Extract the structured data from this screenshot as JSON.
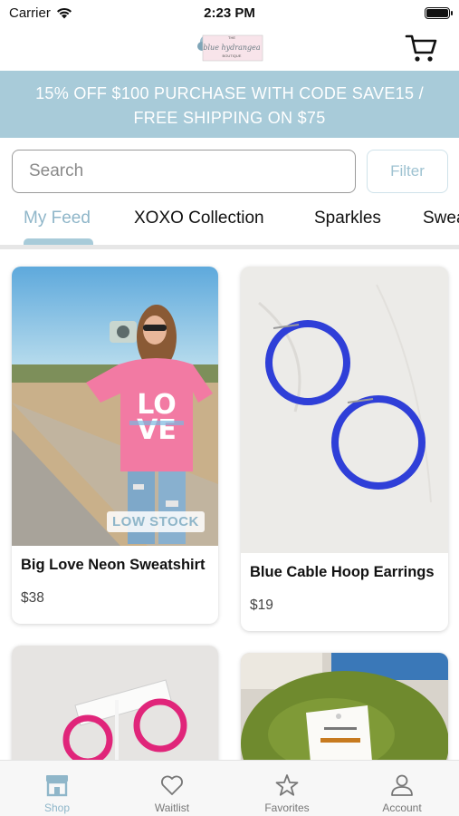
{
  "status_bar": {
    "carrier": "Carrier",
    "time": "2:23 PM"
  },
  "header": {
    "logo_text": "the blue hydrangea boutique",
    "cart_icon": "cart-icon"
  },
  "promo": {
    "line1": "15% OFF $100 PURCHASE WITH CODE SAVE15 /",
    "line2": "FREE SHIPPING ON $75"
  },
  "search": {
    "placeholder": "Search",
    "filter_label": "Filter"
  },
  "tabs": [
    {
      "label": "My Feed",
      "active": true
    },
    {
      "label": "XOXO Collection",
      "active": false
    },
    {
      "label": "Sparkles",
      "active": false
    },
    {
      "label": "Swea",
      "active": false
    }
  ],
  "products": [
    {
      "title": "Big Love Neon Sweatshirt",
      "price": "$38",
      "badge": "LOW STOCK"
    },
    {
      "title": "Blue Cable Hoop Earrings",
      "price": "$19",
      "badge": ""
    },
    {
      "title": "",
      "price": "",
      "badge": ""
    },
    {
      "title": "",
      "price": "",
      "badge": ""
    }
  ],
  "bottom_nav": [
    {
      "label": "Shop",
      "icon": "shop-icon",
      "active": true
    },
    {
      "label": "Waitlist",
      "icon": "heart-icon",
      "active": false
    },
    {
      "label": "Favorites",
      "icon": "star-icon",
      "active": false
    },
    {
      "label": "Account",
      "icon": "account-icon",
      "active": false
    }
  ],
  "colors": {
    "accent": "#a8cbd9",
    "accent_text": "#8fb6c9",
    "earring_blue": "#2f3fd8",
    "earring_pink": "#e0257a"
  }
}
